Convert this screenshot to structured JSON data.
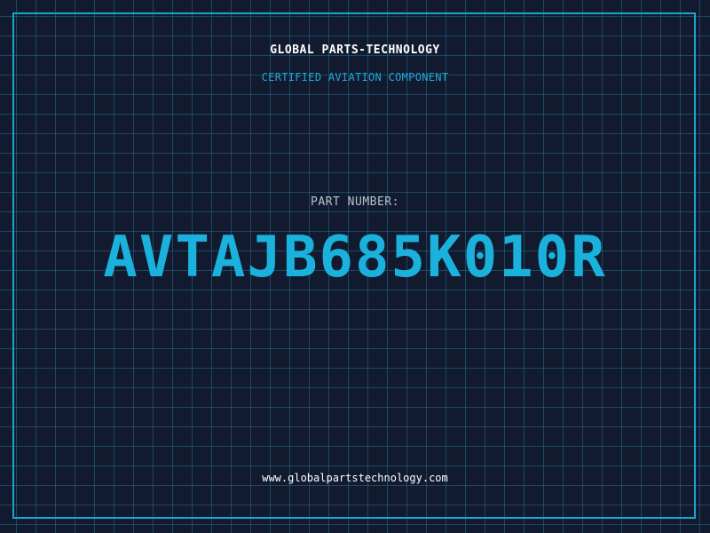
{
  "header": {
    "company": "GLOBAL PARTS-TECHNOLOGY",
    "subtitle": "CERTIFIED AVIATION COMPONENT"
  },
  "part": {
    "label": "PART NUMBER:",
    "number": "AVTAJB685K010R"
  },
  "footer": {
    "url": "www.globalpartstechnology.com"
  },
  "colors": {
    "background": "#111a2e",
    "grid": "#266e8c",
    "accent": "#1ab2dd",
    "frame": "#1aa3cc"
  }
}
